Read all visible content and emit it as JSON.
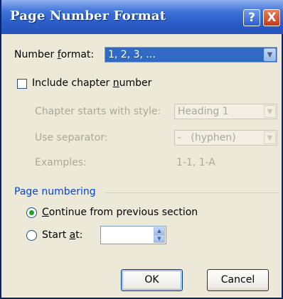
{
  "window": {
    "title": "Page Number Format"
  },
  "titlebar": {
    "help_glyph": "?",
    "close_glyph": "X"
  },
  "number_format": {
    "label_pre": "Number ",
    "label_mnem": "f",
    "label_post": "ormat:",
    "value": "1, 2, 3, ..."
  },
  "include_chapter": {
    "label_pre": "Include chapter ",
    "label_mnem": "n",
    "label_post": "umber",
    "checked": false
  },
  "chapter_style": {
    "label": "Chapter starts with style:",
    "value": "Heading 1"
  },
  "separator": {
    "label": "Use separator:",
    "value": "-   (hyphen)"
  },
  "examples": {
    "label": "Examples:",
    "value": "1-1, 1-A"
  },
  "page_numbering": {
    "heading": "Page numbering",
    "continue": {
      "label_pre": "",
      "label_mnem": "C",
      "label_post": "ontinue from previous section",
      "selected": true
    },
    "start_at": {
      "label_pre": "Start ",
      "label_mnem": "a",
      "label_post": "t:",
      "selected": false,
      "value": ""
    }
  },
  "buttons": {
    "ok": "OK",
    "cancel": "Cancel"
  },
  "colors": {
    "title_bar": "#2A5BC7",
    "selection": "#316AC5",
    "dialog_bg": "#ECE9D8"
  }
}
